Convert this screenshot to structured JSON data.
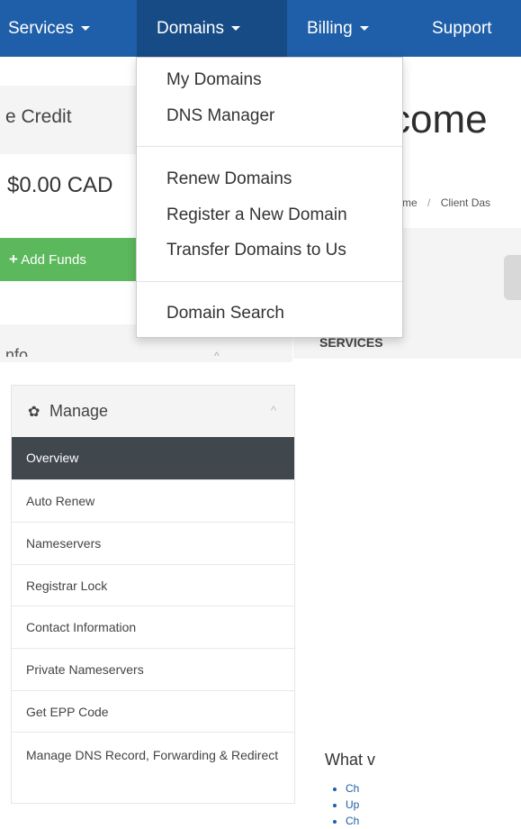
{
  "nav": {
    "items": [
      {
        "label": "Services"
      },
      {
        "label": "Domains"
      },
      {
        "label": "Billing"
      },
      {
        "label": "Support"
      }
    ]
  },
  "domains_menu": {
    "group1": [
      "My Domains",
      "DNS Manager"
    ],
    "group2": [
      "Renew Domains",
      "Register a New Domain",
      "Transfer Domains to Us"
    ],
    "group3": [
      "Domain Search"
    ]
  },
  "credit": {
    "title": "e Credit",
    "value": "$0.00 CAD",
    "add_funds_label": "Add Funds"
  },
  "info_panel": {
    "title": "nfo"
  },
  "welcome": {
    "title": "come"
  },
  "breadcrumb": {
    "home": "me",
    "separator": "/",
    "current": "Client Das"
  },
  "services": {
    "heading": "SERVICES"
  },
  "manage": {
    "title": "Manage",
    "items": [
      {
        "label": "Overview"
      },
      {
        "label": "Auto Renew"
      },
      {
        "label": "Nameservers"
      },
      {
        "label": "Registrar Lock"
      },
      {
        "label": "Contact Information"
      },
      {
        "label": "Private Nameservers"
      },
      {
        "label": "Get EPP Code"
      },
      {
        "label": "Manage DNS Record, Forwarding & Redirect"
      }
    ]
  },
  "what": {
    "text": "What v"
  },
  "bullets": [
    "Ch",
    "Up",
    "Ch"
  ],
  "colors": {
    "nav_bg": "#1f5ea8",
    "nav_active": "#174b86",
    "green": "#5cb85c",
    "active_menu": "#40474d"
  },
  "icons": {
    "caret": "caret-down-icon",
    "gear": "gear-icon",
    "plus": "plus-icon",
    "chevron": "chevron-up-icon"
  }
}
